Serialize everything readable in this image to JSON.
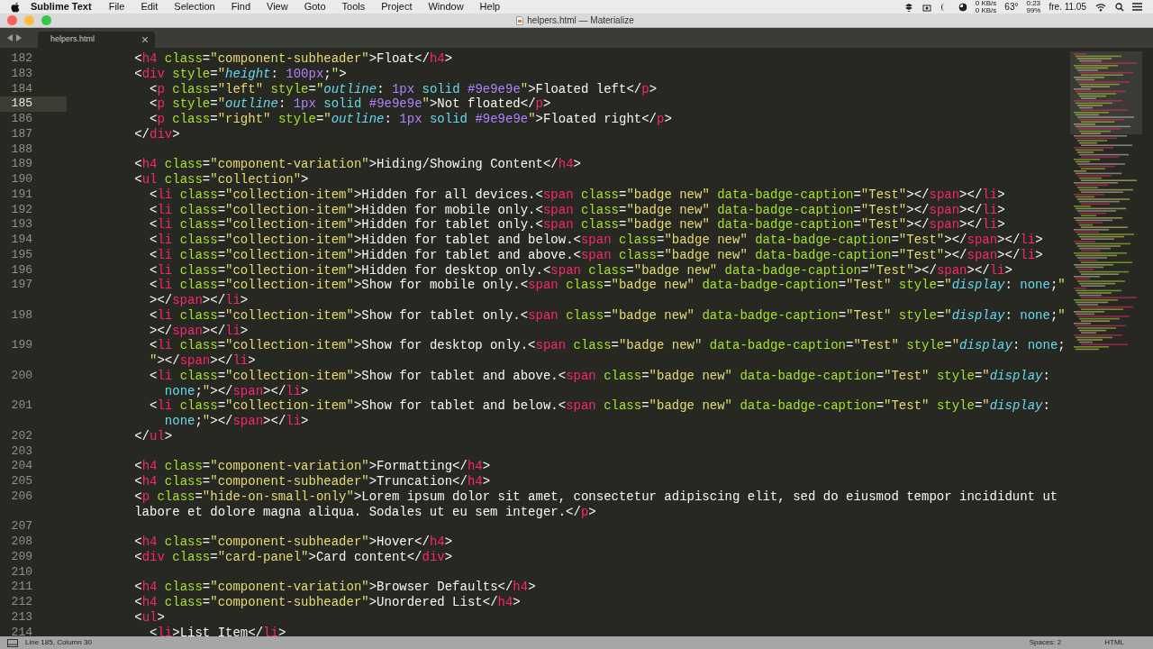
{
  "menu_bar": {
    "app": "Sublime Text",
    "menus": [
      "File",
      "Edit",
      "Selection",
      "Find",
      "View",
      "Goto",
      "Tools",
      "Project",
      "Window",
      "Help"
    ],
    "status_items": [
      {
        "kind": "netspeed",
        "rows": [
          "0 KB/s",
          "0 KB/s"
        ]
      },
      {
        "kind": "text",
        "text": "63°"
      },
      {
        "kind": "netspeed",
        "rows": [
          "0:23",
          "99%"
        ]
      },
      {
        "kind": "text",
        "text": "fre. 11.05"
      }
    ]
  },
  "window": {
    "title": "helpers.html — Materialize"
  },
  "tabs": [
    {
      "label": "helpers.html",
      "selected": true
    }
  ],
  "editor": {
    "lines": [
      {
        "number": "182",
        "current": false,
        "rows": [
          "        <h4 class=\"component-subheader\">Float</h4>"
        ]
      },
      {
        "number": "183",
        "current": false,
        "rows": [
          "        <div style=\"height: 100px;\">"
        ]
      },
      {
        "number": "184",
        "current": false,
        "rows": [
          "          <p class=\"left\" style=\"outline: 1px solid #9e9e9e\">Floated left</p>"
        ]
      },
      {
        "number": "185",
        "current": true,
        "rows": [
          "          <p style=\"outline: 1px solid #9e9e9e\">Not floated</p>"
        ]
      },
      {
        "number": "186",
        "current": false,
        "rows": [
          "          <p class=\"right\" style=\"outline: 1px solid #9e9e9e\">Floated right</p>"
        ]
      },
      {
        "number": "187",
        "current": false,
        "rows": [
          "        </div>"
        ]
      },
      {
        "number": "188",
        "current": false
      },
      {
        "number": "189",
        "current": false,
        "rows": [
          "        <h4 class=\"component-variation\">Hiding/Showing Content</h4>"
        ]
      },
      {
        "number": "190",
        "current": false,
        "rows": [
          "        <ul class=\"collection\">"
        ]
      },
      {
        "number": "191",
        "current": false,
        "rows": [
          "          <li class=\"collection-item\">Hidden for all devices.<span class=\"badge new\" data-badge-caption=\"Test\"></span></li>"
        ]
      },
      {
        "number": "192",
        "current": false,
        "rows": [
          "          <li class=\"collection-item\">Hidden for mobile only.<span class=\"badge new\" data-badge-caption=\"Test\"></span></li>"
        ]
      },
      {
        "number": "193",
        "current": false,
        "rows": [
          "          <li class=\"collection-item\">Hidden for tablet only.<span class=\"badge new\" data-badge-caption=\"Test\"></span></li>"
        ]
      },
      {
        "number": "194",
        "current": false,
        "rows": [
          "          <li class=\"collection-item\">Hidden for tablet and below.<span class=\"badge new\" data-badge-caption=\"Test\"></span></li>"
        ]
      },
      {
        "number": "195",
        "current": false,
        "rows": [
          "          <li class=\"collection-item\">Hidden for tablet and above.<span class=\"badge new\" data-badge-caption=\"Test\"></span></li>"
        ]
      },
      {
        "number": "196",
        "current": false,
        "rows": [
          "          <li class=\"collection-item\">Hidden for desktop only.<span class=\"badge new\" data-badge-caption=\"Test\"></span></li>"
        ]
      },
      {
        "number": "197",
        "current": false,
        "rows": [
          "          <li class=\"collection-item\">Show for mobile only.<span class=\"badge new\" data-badge-caption=\"Test\" style=\"display: none;\"",
          "          ></span></li>"
        ]
      },
      {
        "number": "198",
        "current": false,
        "rows": [
          "          <li class=\"collection-item\">Show for tablet only.<span class=\"badge new\" data-badge-caption=\"Test\" style=\"display: none;\"",
          "          ></span></li>"
        ]
      },
      {
        "number": "199",
        "current": false,
        "rows": [
          "          <li class=\"collection-item\">Show for desktop only.<span class=\"badge new\" data-badge-caption=\"Test\" style=\"display: none;",
          "          \"></span></li>"
        ]
      },
      {
        "number": "200",
        "current": false,
        "rows": [
          "          <li class=\"collection-item\">Show for tablet and above.<span class=\"badge new\" data-badge-caption=\"Test\" style=\"display:",
          "            none;\"></span></li>"
        ]
      },
      {
        "number": "201",
        "current": false,
        "rows": [
          "          <li class=\"collection-item\">Show for tablet and below.<span class=\"badge new\" data-badge-caption=\"Test\" style=\"display:",
          "            none;\"></span></li>"
        ]
      },
      {
        "number": "202",
        "current": false,
        "rows": [
          "        </ul>"
        ]
      },
      {
        "number": "203",
        "current": false
      },
      {
        "number": "204",
        "current": false,
        "rows": [
          "        <h4 class=\"component-variation\">Formatting</h4>"
        ]
      },
      {
        "number": "205",
        "current": false,
        "rows": [
          "        <h4 class=\"component-subheader\">Truncation</h4>"
        ]
      },
      {
        "number": "206",
        "current": false,
        "rows": [
          "        <p class=\"hide-on-small-only\">Lorem ipsum dolor sit amet, consectetur adipiscing elit, sed do eiusmod tempor incididunt ut",
          "        labore et dolore magna aliqua. Sodales ut eu sem integer.</p>"
        ]
      },
      {
        "number": "207",
        "current": false
      },
      {
        "number": "208",
        "current": false,
        "rows": [
          "        <h4 class=\"component-subheader\">Hover</h4>"
        ]
      },
      {
        "number": "209",
        "current": false,
        "rows": [
          "        <div class=\"card-panel\">Card content</div>"
        ]
      },
      {
        "number": "210",
        "current": false
      },
      {
        "number": "211",
        "current": false,
        "rows": [
          "        <h4 class=\"component-variation\">Browser Defaults</h4>"
        ]
      },
      {
        "number": "212",
        "current": false,
        "rows": [
          "        <h4 class=\"component-subheader\">Unordered List</h4>"
        ]
      },
      {
        "number": "213",
        "current": false,
        "rows": [
          "        <ul>"
        ]
      },
      {
        "number": "214",
        "current": false,
        "rows": [
          "          <li>List Item</li>"
        ]
      }
    ]
  },
  "status_bar": {
    "position": "Line 185, Column 30",
    "indentation": "Spaces: 2",
    "syntax": "HTML"
  }
}
